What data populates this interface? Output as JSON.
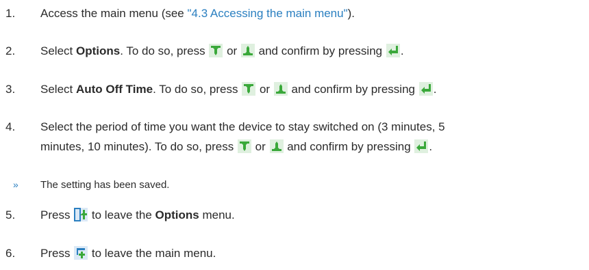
{
  "steps": [
    {
      "number": "1.",
      "text_a": "Access the main menu (see ",
      "link": "\"4.3 Accessing the main menu\"",
      "text_b": ")."
    },
    {
      "number": "2.",
      "lead": "Select ",
      "bold": "Options",
      "mid": ". To do so, press ",
      "or": " or ",
      "confirm": " and confirm by pressing ",
      "end": "."
    },
    {
      "number": "3.",
      "lead": "Select ",
      "bold": "Auto Off Time",
      "mid": ". To do so, press ",
      "or": " or ",
      "confirm": " and confirm by pressing ",
      "end": "."
    },
    {
      "number": "4.",
      "line1": "Select the period of time you want the device to stay switched on (3 minutes, 5",
      "line2": "minutes, 10 minutes). To do so, press ",
      "or": " or ",
      "confirm": " and confirm by pressing ",
      "end": "."
    },
    {
      "number": "5.",
      "lead": "Press ",
      "mid": " to leave the ",
      "bold": "Options",
      "end": " menu."
    },
    {
      "number": "6.",
      "lead": "Press ",
      "end": " to leave the main menu."
    }
  ],
  "result": {
    "mark": "»",
    "text": "The setting has been saved."
  },
  "icons": {
    "down": "arrow-down-icon",
    "up": "arrow-up-icon",
    "enter": "enter-icon",
    "back": "back-icon",
    "home": "home-icon"
  },
  "colors": {
    "link": "#2a7fc0",
    "text": "#2b2b2b",
    "icon_green": "#3aa83a",
    "icon_blue": "#2a7fc0"
  }
}
